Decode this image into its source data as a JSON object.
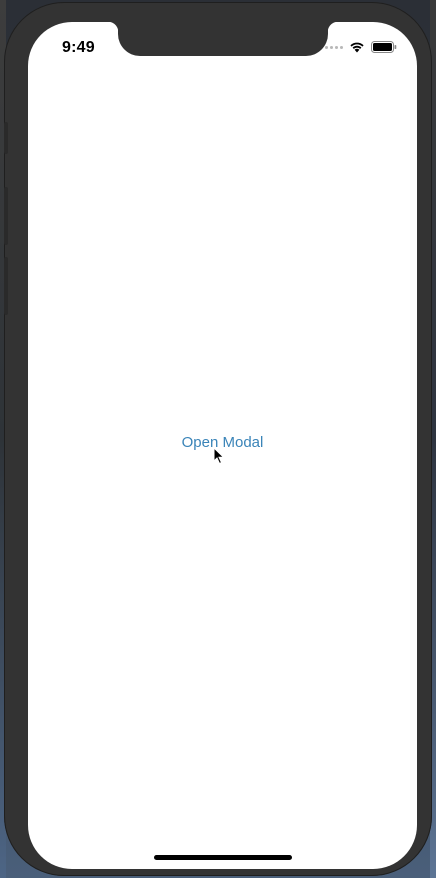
{
  "status_bar": {
    "time": "9:49",
    "icons": [
      "signal-dots-icon",
      "wifi-icon",
      "battery-icon"
    ]
  },
  "main": {
    "open_modal_label": "Open Modal"
  },
  "colors": {
    "link": "#3a84b8",
    "device_frame": "#333333",
    "screen_bg": "#ffffff"
  }
}
